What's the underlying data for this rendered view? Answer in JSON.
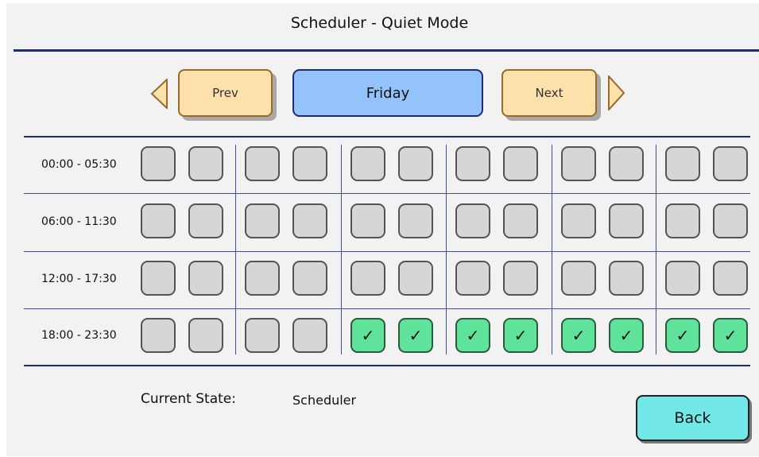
{
  "header": {
    "title": "Scheduler - Quiet Mode"
  },
  "nav": {
    "prev_label": "Prev",
    "next_label": "Next",
    "day": "Friday"
  },
  "schedule": {
    "rows": [
      {
        "label": "00:00 - 05:30",
        "slots": [
          false,
          false,
          false,
          false,
          false,
          false,
          false,
          false,
          false,
          false,
          false,
          false
        ]
      },
      {
        "label": "06:00 - 11:30",
        "slots": [
          false,
          false,
          false,
          false,
          false,
          false,
          false,
          false,
          false,
          false,
          false,
          false
        ]
      },
      {
        "label": "12:00 - 17:30",
        "slots": [
          false,
          false,
          false,
          false,
          false,
          false,
          false,
          false,
          false,
          false,
          false,
          false
        ]
      },
      {
        "label": "18:00 - 23:30",
        "slots": [
          false,
          false,
          false,
          false,
          true,
          true,
          true,
          true,
          true,
          true,
          true,
          true
        ]
      }
    ],
    "check_glyph": "✓"
  },
  "status": {
    "label": "Current State:",
    "value": "Scheduler"
  },
  "footer": {
    "back_label": "Back"
  },
  "colors": {
    "accent_line": "#1f2a78",
    "nav_button": "#fde0aa",
    "day_box": "#93c3fa",
    "slot_off": "#d6d6d6",
    "slot_on": "#5fe39a",
    "back_button": "#72e8e8"
  }
}
